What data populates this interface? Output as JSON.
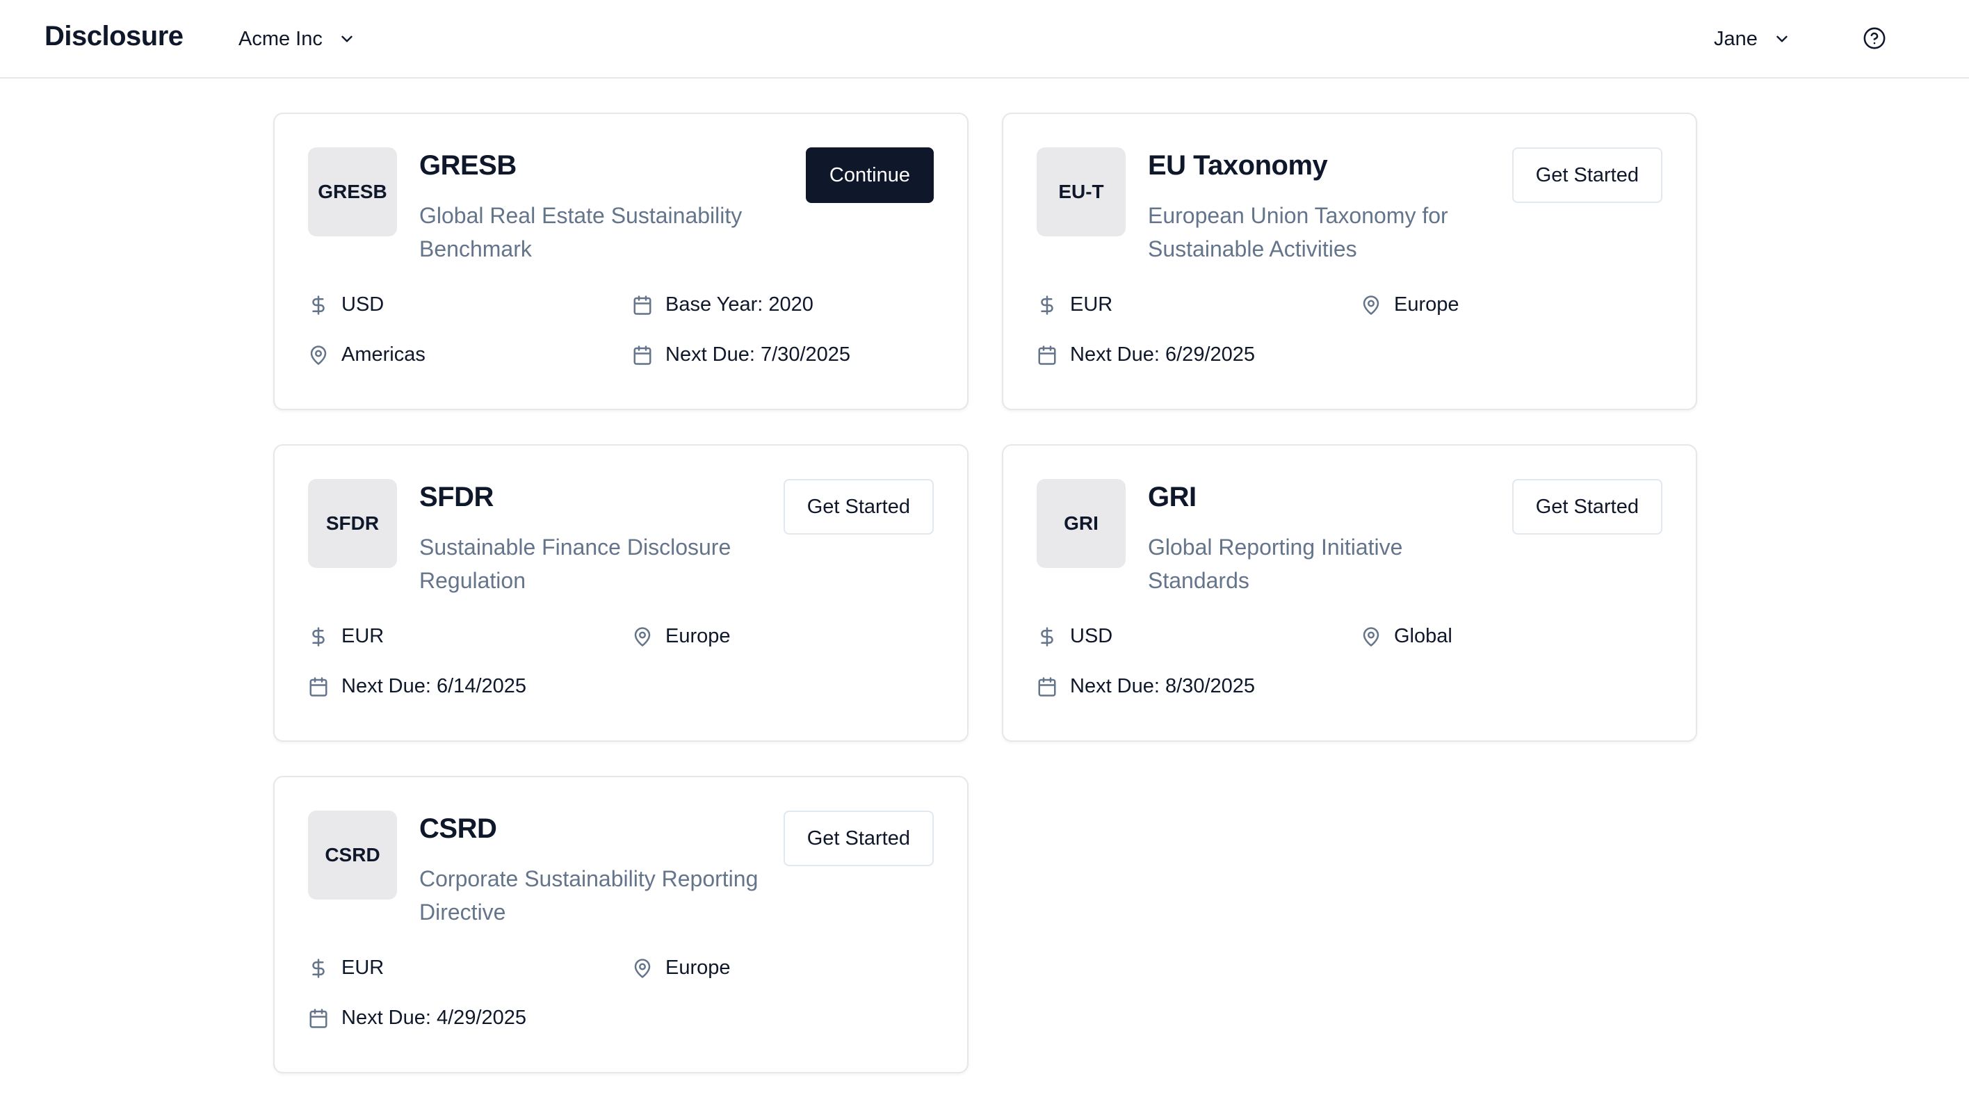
{
  "header": {
    "brand": "Disclosure",
    "org": "Acme Inc",
    "user": "Jane"
  },
  "cards": [
    {
      "badge": "GRESB",
      "title": "GRESB",
      "description": "Global Real Estate Sustainability Benchmark",
      "button": "Continue",
      "meta": [
        "USD",
        "Base Year: 2020",
        "Americas",
        "Next Due: 7/30/2025"
      ]
    },
    {
      "badge": "EU-T",
      "title": "EU Taxonomy",
      "description": "European Union Taxonomy for Sustainable Activities",
      "button": "Get Started",
      "meta": [
        "EUR",
        "Europe",
        "Next Due: 6/29/2025"
      ]
    },
    {
      "badge": "SFDR",
      "title": "SFDR",
      "description": "Sustainable Finance Disclosure Regulation",
      "button": "Get Started",
      "meta": [
        "EUR",
        "Europe",
        "Next Due: 6/14/2025"
      ]
    },
    {
      "badge": "GRI",
      "title": "GRI",
      "description": "Global Reporting Initiative Standards",
      "button": "Get Started",
      "meta": [
        "USD",
        "Global",
        "Next Due: 8/30/2025"
      ]
    },
    {
      "badge": "CSRD",
      "title": "CSRD",
      "description": "Corporate Sustainability Reporting Directive",
      "button": "Get Started",
      "meta": [
        "EUR",
        "Europe",
        "Next Due: 4/29/2025"
      ]
    }
  ],
  "icons": {
    "currency": "dollar-sign-icon",
    "region": "map-pin-icon",
    "date": "calendar-icon",
    "help": "help-circle-icon",
    "dropdown": "chevron-down-icon"
  },
  "colors": {
    "primary": "#0f172a",
    "muted_text": "#64748b",
    "border": "#e5e7eb",
    "badge_bg": "#e9e9eb",
    "icon": "#64748b"
  }
}
